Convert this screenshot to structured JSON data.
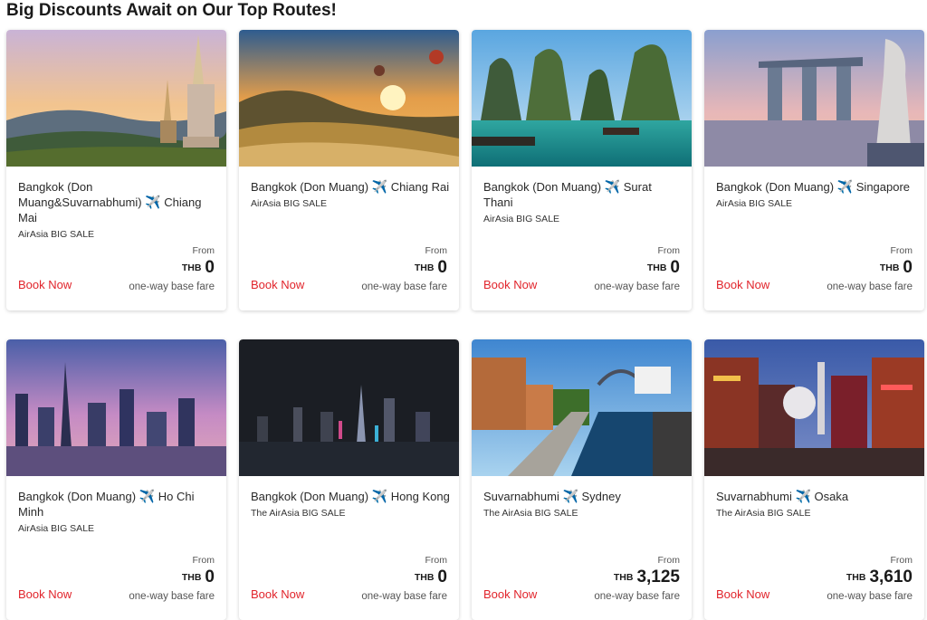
{
  "page": {
    "title": "Big Discounts Await on Our Top Routes!"
  },
  "cards": [
    {
      "origin": "Bangkok (Don Muang&Suvarnabhumi)",
      "destination": "Chiang Mai",
      "sale": "AirAsia BIG SALE",
      "from": "From",
      "currency": "THB",
      "price": "0",
      "book": "Book Now",
      "fare": "one-way base fare"
    },
    {
      "origin": "Bangkok (Don Muang)",
      "destination": "Chiang Rai",
      "sale": "AirAsia BIG SALE",
      "from": "From",
      "currency": "THB",
      "price": "0",
      "book": "Book Now",
      "fare": "one-way base fare"
    },
    {
      "origin": "Bangkok (Don Muang)",
      "destination": "Surat Thani",
      "sale": "AirAsia BIG SALE",
      "from": "From",
      "currency": "THB",
      "price": "0",
      "book": "Book Now",
      "fare": "one-way base fare"
    },
    {
      "origin": "Bangkok (Don Muang)",
      "destination": "Singapore",
      "sale": "AirAsia BIG SALE",
      "from": "From",
      "currency": "THB",
      "price": "0",
      "book": "Book Now",
      "fare": "one-way base fare"
    },
    {
      "origin": "Bangkok (Don Muang)",
      "destination": "Ho Chi Minh",
      "sale": "AirAsia BIG SALE",
      "from": "From",
      "currency": "THB",
      "price": "0",
      "book": "Book Now",
      "fare": "one-way base fare"
    },
    {
      "origin": "Bangkok (Don Muang)",
      "destination": "Hong Kong",
      "sale": "The AirAsia BIG SALE",
      "from": "From",
      "currency": "THB",
      "price": "0",
      "book": "Book Now",
      "fare": "one-way base fare"
    },
    {
      "origin": "Suvarnabhumi",
      "destination": "Sydney",
      "sale": "The AirAsia BIG SALE",
      "from": "From",
      "currency": "THB",
      "price": "3,125",
      "book": "Book Now",
      "fare": "one-way base fare"
    },
    {
      "origin": "Suvarnabhumi",
      "destination": "Osaka",
      "sale": "The AirAsia BIG SALE",
      "from": "From",
      "currency": "THB",
      "price": "3,610",
      "book": "Book Now",
      "fare": "one-way base fare"
    }
  ],
  "theme": {
    "accent": "#e1242b",
    "plane_icon": "airplane-icon"
  }
}
